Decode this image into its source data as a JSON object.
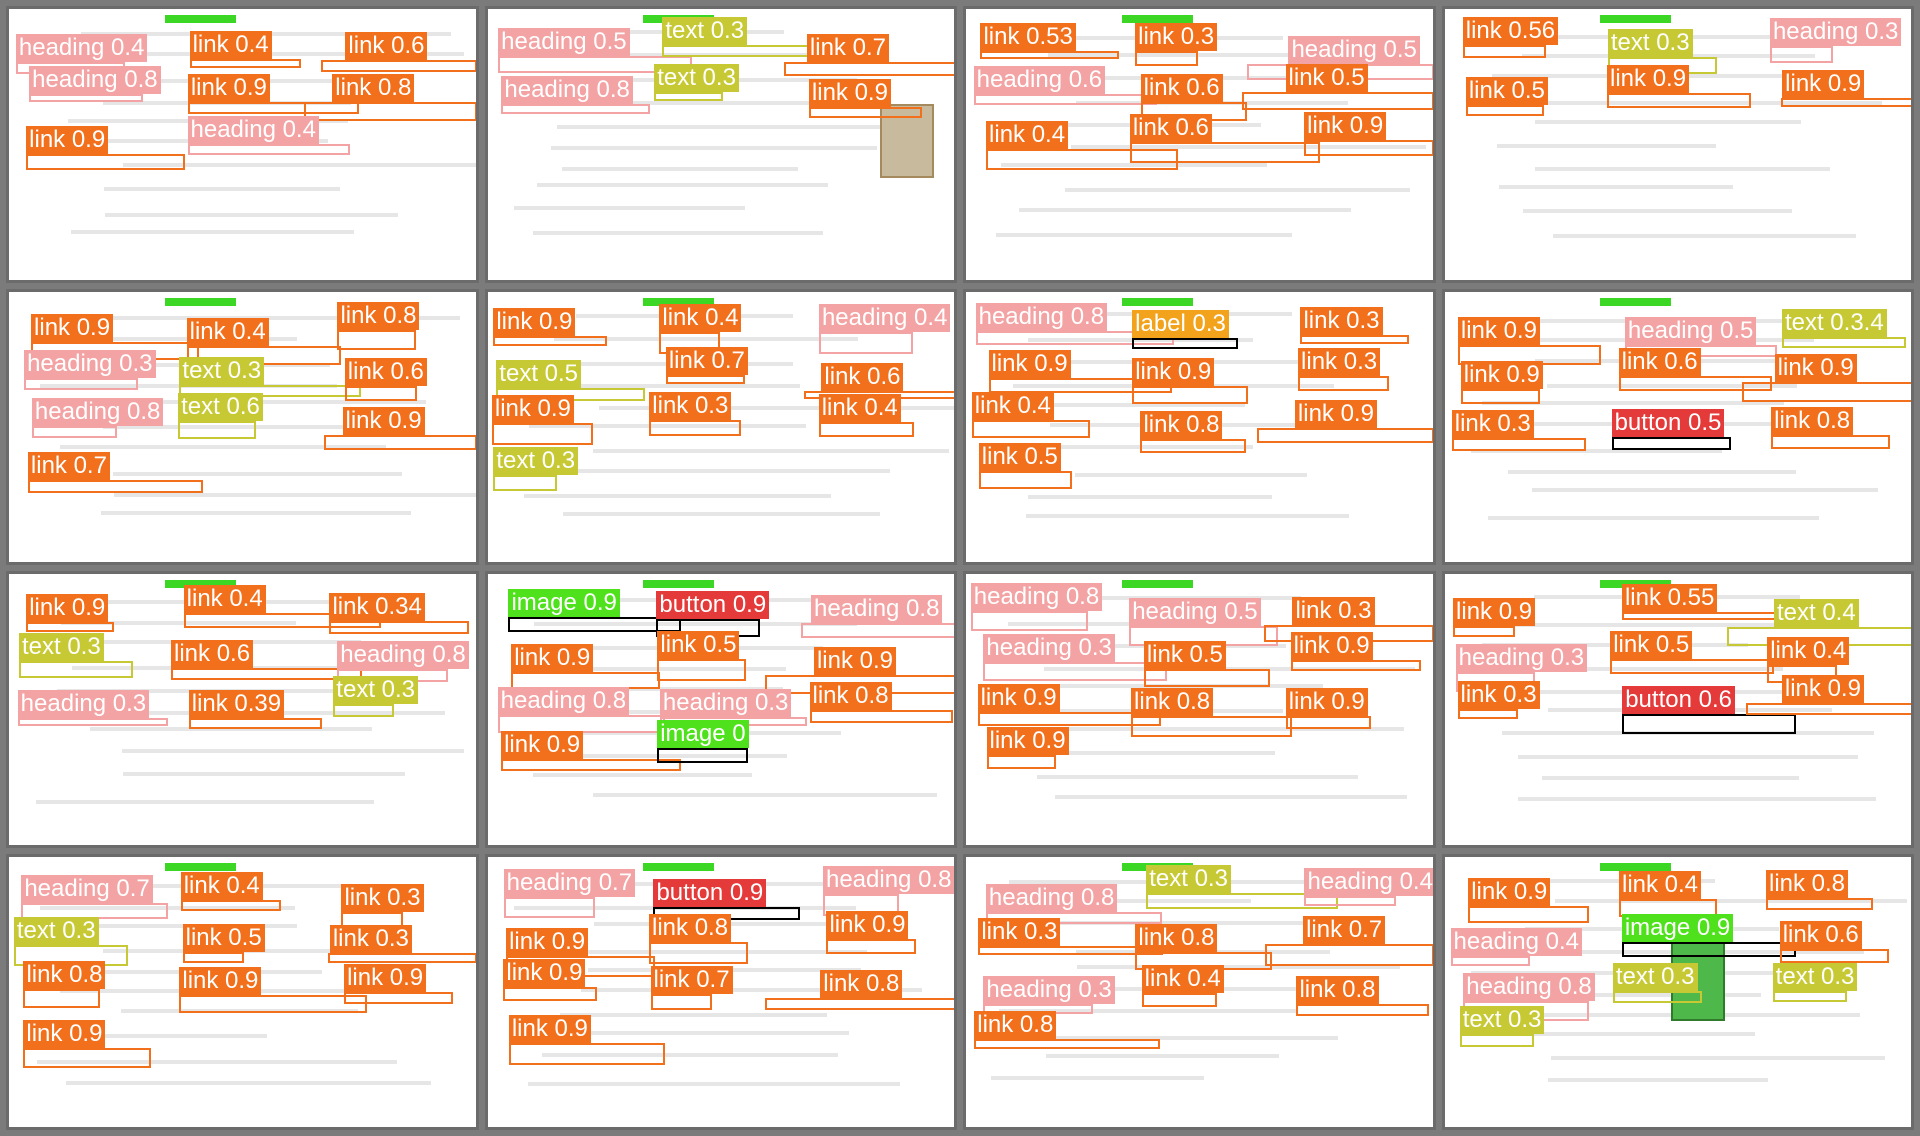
{
  "grid": {
    "tiles": [
      {
        "dets": [
          {
            "cls": "heading",
            "text": "heading 0.4"
          },
          {
            "cls": "link",
            "text": "link 0.4"
          },
          {
            "cls": "link",
            "text": "link 0.6"
          },
          {
            "cls": "heading",
            "text": "heading 0.8"
          },
          {
            "cls": "link",
            "text": "link 0.9"
          },
          {
            "cls": "link",
            "text": "link 0.8"
          },
          {
            "cls": "link",
            "text": "link 0.9"
          },
          {
            "cls": "heading",
            "text": "heading 0.4"
          }
        ]
      },
      {
        "dets": [
          {
            "cls": "heading",
            "text": "heading 0.5"
          },
          {
            "cls": "text",
            "text": "text 0.3"
          },
          {
            "cls": "link",
            "text": "link 0.7"
          },
          {
            "cls": "heading",
            "text": "heading 0.8"
          },
          {
            "cls": "text",
            "text": "text 0.3"
          },
          {
            "cls": "link",
            "text": "link 0.9"
          }
        ]
      },
      {
        "dets": [
          {
            "cls": "link",
            "text": "link 0.53"
          },
          {
            "cls": "link",
            "text": "link 0.3"
          },
          {
            "cls": "heading",
            "text": "heading 0.5"
          },
          {
            "cls": "heading",
            "text": "heading 0.6"
          },
          {
            "cls": "link",
            "text": "link 0.6"
          },
          {
            "cls": "link",
            "text": "link 0.5"
          },
          {
            "cls": "link",
            "text": "link 0.4"
          },
          {
            "cls": "link",
            "text": "link 0.6"
          },
          {
            "cls": "link",
            "text": "link 0.9"
          }
        ]
      },
      {
        "dets": [
          {
            "cls": "link",
            "text": "link 0.56"
          },
          {
            "cls": "text",
            "text": "text 0.3"
          },
          {
            "cls": "heading",
            "text": "heading 0.3"
          },
          {
            "cls": "link",
            "text": "link 0.5"
          },
          {
            "cls": "link",
            "text": "link 0.9"
          },
          {
            "cls": "link",
            "text": "link 0.9"
          }
        ]
      },
      {
        "dets": [
          {
            "cls": "link",
            "text": "link 0.9"
          },
          {
            "cls": "link",
            "text": "link 0.4"
          },
          {
            "cls": "link",
            "text": "link 0.8"
          },
          {
            "cls": "heading",
            "text": "heading 0.3"
          },
          {
            "cls": "text",
            "text": "text 0.3"
          },
          {
            "cls": "link",
            "text": "link 0.6"
          },
          {
            "cls": "heading",
            "text": "heading 0.8"
          },
          {
            "cls": "text",
            "text": "text 0.6"
          },
          {
            "cls": "link",
            "text": "link 0.9"
          },
          {
            "cls": "link",
            "text": "link 0.7"
          }
        ]
      },
      {
        "dets": [
          {
            "cls": "link",
            "text": "link 0.9"
          },
          {
            "cls": "link",
            "text": "link 0.4"
          },
          {
            "cls": "heading",
            "text": "heading 0.4"
          },
          {
            "cls": "text",
            "text": "text 0.5"
          },
          {
            "cls": "link",
            "text": "link 0.7"
          },
          {
            "cls": "link",
            "text": "link 0.6"
          },
          {
            "cls": "link",
            "text": "link 0.9"
          },
          {
            "cls": "link",
            "text": "link 0.3"
          },
          {
            "cls": "link",
            "text": "link 0.4"
          },
          {
            "cls": "text",
            "text": "text 0.3"
          }
        ]
      },
      {
        "dets": [
          {
            "cls": "heading",
            "text": "heading 0.8"
          },
          {
            "cls": "label",
            "text": "label 0.3"
          },
          {
            "cls": "link",
            "text": "link 0.3"
          },
          {
            "cls": "link",
            "text": "link 0.9"
          },
          {
            "cls": "link",
            "text": "link 0.9"
          },
          {
            "cls": "link",
            "text": "link 0.3"
          },
          {
            "cls": "link",
            "text": "link 0.4"
          },
          {
            "cls": "link",
            "text": "link 0.8"
          },
          {
            "cls": "link",
            "text": "link 0.9"
          },
          {
            "cls": "link",
            "text": "link 0.5"
          }
        ]
      },
      {
        "dets": [
          {
            "cls": "link",
            "text": "link 0.9"
          },
          {
            "cls": "heading",
            "text": "heading 0.5"
          },
          {
            "cls": "text",
            "text": "text 0.3.4"
          },
          {
            "cls": "link",
            "text": "link 0.9"
          },
          {
            "cls": "link",
            "text": "link 0.6"
          },
          {
            "cls": "link",
            "text": "link 0.9"
          },
          {
            "cls": "link",
            "text": "link 0.3"
          },
          {
            "cls": "button",
            "text": "button 0.5"
          },
          {
            "cls": "link",
            "text": "link 0.8"
          }
        ]
      },
      {
        "dets": [
          {
            "cls": "link",
            "text": "link 0.9"
          },
          {
            "cls": "link",
            "text": "link 0.4"
          },
          {
            "cls": "link",
            "text": "link 0.34"
          },
          {
            "cls": "text",
            "text": "text 0.3"
          },
          {
            "cls": "link",
            "text": "link 0.6"
          },
          {
            "cls": "heading",
            "text": "heading 0.8"
          },
          {
            "cls": "heading",
            "text": "heading 0.3"
          },
          {
            "cls": "link",
            "text": "link 0.39"
          },
          {
            "cls": "text",
            "text": "text 0.3"
          }
        ]
      },
      {
        "dets": [
          {
            "cls": "image",
            "text": "image 0.9"
          },
          {
            "cls": "button",
            "text": "button 0.9"
          },
          {
            "cls": "heading",
            "text": "heading 0.8"
          },
          {
            "cls": "link",
            "text": "link 0.9"
          },
          {
            "cls": "link",
            "text": "link 0.5"
          },
          {
            "cls": "link",
            "text": "link 0.9"
          },
          {
            "cls": "heading",
            "text": "heading 0.8"
          },
          {
            "cls": "heading",
            "text": "heading 0.3"
          },
          {
            "cls": "link",
            "text": "link 0.8"
          },
          {
            "cls": "link",
            "text": "link 0.9"
          },
          {
            "cls": "image",
            "text": "image 0"
          }
        ]
      },
      {
        "dets": [
          {
            "cls": "heading",
            "text": "heading 0.8"
          },
          {
            "cls": "heading",
            "text": "heading 0.5"
          },
          {
            "cls": "link",
            "text": "link 0.3"
          },
          {
            "cls": "heading",
            "text": "heading 0.3"
          },
          {
            "cls": "link",
            "text": "link 0.5"
          },
          {
            "cls": "link",
            "text": "link 0.9"
          },
          {
            "cls": "link",
            "text": "link 0.9"
          },
          {
            "cls": "link",
            "text": "link 0.8"
          },
          {
            "cls": "link",
            "text": "link 0.9"
          },
          {
            "cls": "link",
            "text": "link 0.9"
          }
        ]
      },
      {
        "dets": [
          {
            "cls": "link",
            "text": "link 0.9"
          },
          {
            "cls": "link",
            "text": "link 0.55"
          },
          {
            "cls": "text",
            "text": "text 0.4"
          },
          {
            "cls": "heading",
            "text": "heading 0.3"
          },
          {
            "cls": "link",
            "text": "link 0.5"
          },
          {
            "cls": "link",
            "text": "link 0.4"
          },
          {
            "cls": "link",
            "text": "link 0.3"
          },
          {
            "cls": "button",
            "text": "button 0.6"
          },
          {
            "cls": "link",
            "text": "link 0.9"
          }
        ]
      },
      {
        "dets": [
          {
            "cls": "heading",
            "text": "heading 0.7"
          },
          {
            "cls": "link",
            "text": "link 0.4"
          },
          {
            "cls": "link",
            "text": "link 0.3"
          },
          {
            "cls": "text",
            "text": "text 0.3"
          },
          {
            "cls": "link",
            "text": "link 0.5"
          },
          {
            "cls": "link",
            "text": "link 0.3"
          },
          {
            "cls": "link",
            "text": "link 0.8"
          },
          {
            "cls": "link",
            "text": "link 0.9"
          },
          {
            "cls": "link",
            "text": "link 0.9"
          },
          {
            "cls": "link",
            "text": "link 0.9"
          }
        ]
      },
      {
        "dets": [
          {
            "cls": "heading",
            "text": "heading 0.7"
          },
          {
            "cls": "button",
            "text": "button 0.9"
          },
          {
            "cls": "heading",
            "text": "heading 0.8"
          },
          {
            "cls": "link",
            "text": "link 0.9"
          },
          {
            "cls": "link",
            "text": "link 0.8"
          },
          {
            "cls": "link",
            "text": "link 0.9"
          },
          {
            "cls": "link",
            "text": "link 0.9"
          },
          {
            "cls": "link",
            "text": "link 0.7"
          },
          {
            "cls": "link",
            "text": "link 0.8"
          },
          {
            "cls": "link",
            "text": "link 0.9"
          }
        ]
      },
      {
        "dets": [
          {
            "cls": "heading",
            "text": "heading 0.8"
          },
          {
            "cls": "text",
            "text": "text 0.3"
          },
          {
            "cls": "heading",
            "text": "heading 0.4"
          },
          {
            "cls": "link",
            "text": "link 0.3"
          },
          {
            "cls": "link",
            "text": "link 0.8"
          },
          {
            "cls": "link",
            "text": "link 0.7"
          },
          {
            "cls": "heading",
            "text": "heading 0.3"
          },
          {
            "cls": "link",
            "text": "link 0.4"
          },
          {
            "cls": "link",
            "text": "link 0.8"
          },
          {
            "cls": "link",
            "text": "link 0.8"
          }
        ]
      },
      {
        "dets": [
          {
            "cls": "link",
            "text": "link 0.9"
          },
          {
            "cls": "link",
            "text": "link 0.4"
          },
          {
            "cls": "link",
            "text": "link 0.8"
          },
          {
            "cls": "heading",
            "text": "heading 0.4"
          },
          {
            "cls": "image",
            "text": "image 0.9"
          },
          {
            "cls": "link",
            "text": "link 0.6"
          },
          {
            "cls": "heading",
            "text": "heading 0.8"
          },
          {
            "cls": "text",
            "text": "text 0.3"
          },
          {
            "cls": "text",
            "text": "text 0.3"
          },
          {
            "cls": "text",
            "text": "text 0.3"
          }
        ]
      }
    ]
  }
}
